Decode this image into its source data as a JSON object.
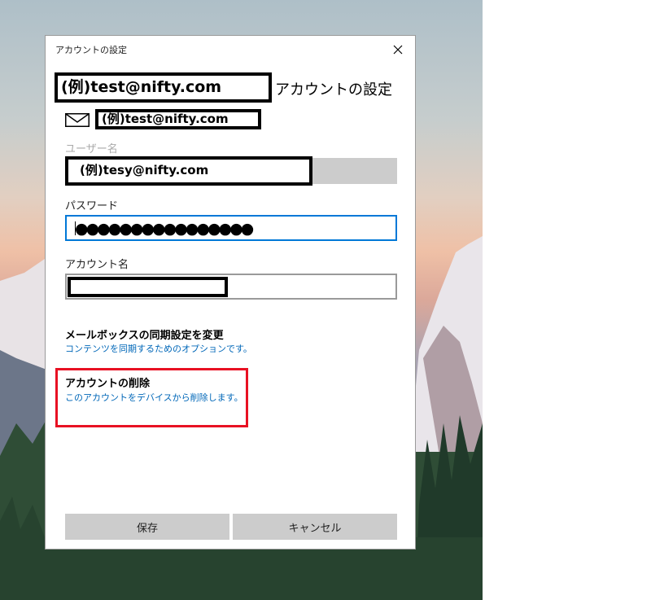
{
  "dialog": {
    "title": "アカウントの設定",
    "close_icon": "close-icon",
    "heading_email": "(例)test@nifty.com",
    "heading_suffix": "アカウントの設定",
    "mail_icon": "mail-icon",
    "email_display": "(例)test@nifty.com",
    "username": {
      "label": "ユーザー名",
      "value": "(例)tesy@nifty.com",
      "disabled": true
    },
    "password": {
      "label": "パスワード",
      "value": "●●●●●●●●●●●●●●●●"
    },
    "account_name": {
      "label": "アカウント名",
      "value": ""
    },
    "sync_settings": {
      "title": "メールボックスの同期設定を変更",
      "description": "コンテンツを同期するためのオプションです。"
    },
    "delete_account": {
      "title": "アカウントの削除",
      "description": "このアカウントをデバイスから削除します。",
      "highlight_color": "#e81123"
    },
    "buttons": {
      "save": "保存",
      "cancel": "キャンセル"
    }
  },
  "colors": {
    "accent": "#0078d7",
    "link": "#0067b8",
    "button_bg": "#cccccc"
  }
}
